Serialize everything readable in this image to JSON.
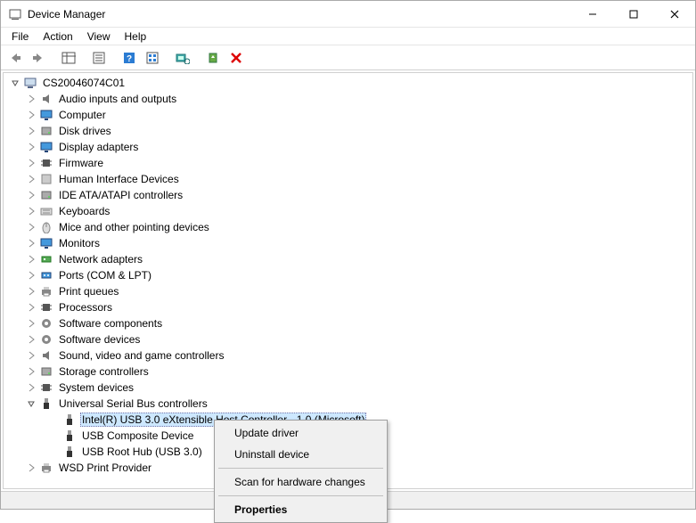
{
  "window": {
    "title": "Device Manager"
  },
  "menu": {
    "file": "File",
    "action": "Action",
    "view": "View",
    "help": "Help"
  },
  "tree": {
    "root": "CS20046074C01",
    "categories": [
      "Audio inputs and outputs",
      "Computer",
      "Disk drives",
      "Display adapters",
      "Firmware",
      "Human Interface Devices",
      "IDE ATA/ATAPI controllers",
      "Keyboards",
      "Mice and other pointing devices",
      "Monitors",
      "Network adapters",
      "Ports (COM & LPT)",
      "Print queues",
      "Processors",
      "Software components",
      "Software devices",
      "Sound, video and game controllers",
      "Storage controllers",
      "System devices"
    ],
    "usb": {
      "label": "Universal Serial Bus controllers",
      "children": [
        "Intel(R) USB 3.0 eXtensible Host Controller - 1.0 (Microsoft)",
        "USB Composite Device",
        "USB Root Hub (USB 3.0)"
      ]
    },
    "last": "WSD Print Provider"
  },
  "context_menu": {
    "update": "Update driver",
    "uninstall": "Uninstall device",
    "scan": "Scan for hardware changes",
    "properties": "Properties"
  }
}
